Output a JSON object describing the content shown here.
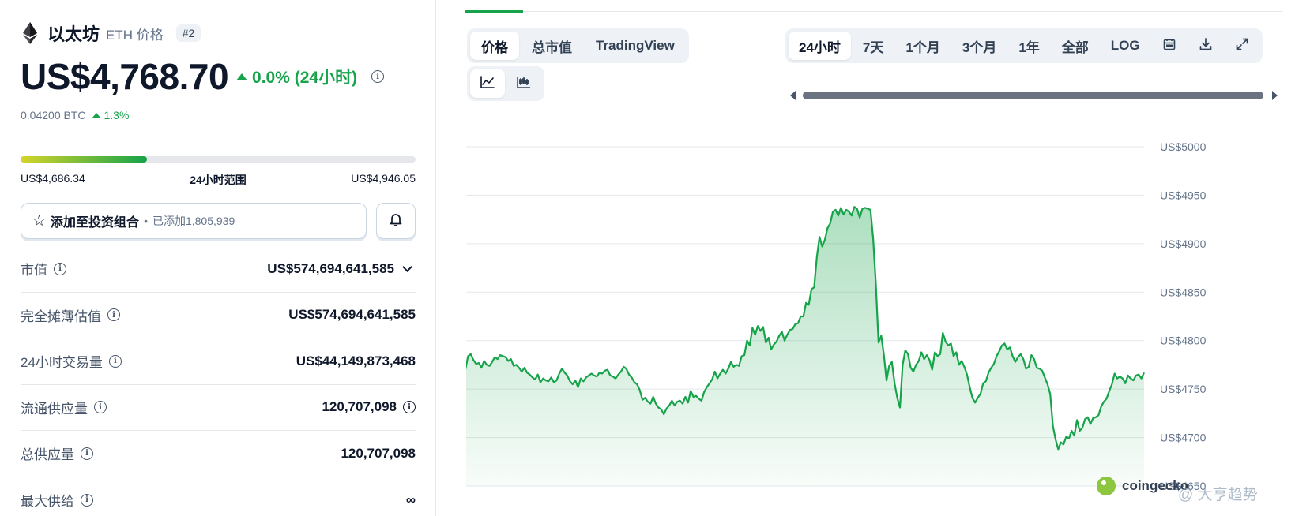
{
  "coin": {
    "name": "以太坊",
    "symbol": "ETH 价格",
    "rank": "#2",
    "price": "US$4,768.70",
    "change_24h": "0.0% (24小时)",
    "btc_price": "0.04200 BTC",
    "btc_change": "1.3%"
  },
  "range_24h": {
    "low": "US$4,686.34",
    "label": "24小时范围",
    "high": "US$4,946.05",
    "fill_fraction": 0.32
  },
  "portfolio": {
    "label": "添加至投资组合",
    "dot": "•",
    "added": "已添加1,805,939"
  },
  "stats": {
    "market_cap": {
      "label": "市值",
      "value": "US$574,694,641,585"
    },
    "fdv": {
      "label": "完全摊薄估值",
      "value": "US$574,694,641,585"
    },
    "volume": {
      "label": "24小时交易量",
      "value": "US$44,149,873,468"
    },
    "circulating": {
      "label": "流通供应量",
      "value": "120,707,098"
    },
    "total": {
      "label": "总供应量",
      "value": "120,707,098"
    },
    "max": {
      "label": "最大供给",
      "value": "∞"
    }
  },
  "chart_tabs": {
    "price": "价格",
    "market_cap": "总市值",
    "tradingview": "TradingView"
  },
  "chart_icons": {
    "line": "line-chart-icon",
    "candle": "candlestick-icon"
  },
  "time_ranges": {
    "h24": "24小时",
    "d7": "7天",
    "m1": "1个月",
    "m3": "3个月",
    "y1": "1年",
    "all": "全部",
    "log": "LOG"
  },
  "tools": {
    "calendar": "calendar-icon",
    "download": "download-icon",
    "expand": "expand-icon"
  },
  "watermark": {
    "brand": "coingecko",
    "source": "@ 大亨趋势"
  },
  "colors": {
    "up": "#16a34a",
    "line": "#16a34a",
    "area_top": "#16a34a"
  },
  "chart_data": {
    "type": "area",
    "title": "",
    "xlabel": "",
    "ylabel": "",
    "ylim": [
      4650,
      5000
    ],
    "yticks": [
      "US$5000",
      "US$4950",
      "US$4900",
      "US$4850",
      "US$4800",
      "US$4750",
      "US$4700",
      "US$4650"
    ],
    "yticks_values": [
      5000,
      4950,
      4900,
      4850,
      4800,
      4750,
      4700,
      4650
    ],
    "grid": true,
    "series": [
      {
        "values": [
          4763,
          4757,
          4762,
          4760,
          4768,
          4770,
          4784,
          4786,
          4780,
          4776,
          4777,
          4772,
          4779,
          4775,
          4774,
          4778,
          4783,
          4781,
          4785,
          4784,
          4783,
          4779,
          4781,
          4774,
          4775,
          4772,
          4768,
          4772,
          4767,
          4765,
          4762,
          4760,
          4765,
          4757,
          4761,
          4759,
          4758,
          4762,
          4757,
          4759,
          4766,
          4771,
          4767,
          4764,
          4758,
          4755,
          4759,
          4752,
          4761,
          4758,
          4762,
          4764,
          4766,
          4764,
          4763,
          4767,
          4766,
          4769,
          4770,
          4764,
          4763,
          4761,
          4765,
          4768,
          4773,
          4771,
          4765,
          4762,
          4757,
          4755,
          4749,
          4739,
          4741,
          4737,
          4735,
          4742,
          4735,
          4731,
          4729,
          4724,
          4730,
          4733,
          4738,
          4733,
          4737,
          4738,
          4735,
          4742,
          4736,
          4748,
          4742,
          4743,
          4740,
          4738,
          4747,
          4752,
          4756,
          4760,
          4768,
          4761,
          4766,
          4770,
          4766,
          4771,
          4778,
          4773,
          4775,
          4774,
          4784,
          4785,
          4800,
          4795,
          4813,
          4806,
          4815,
          4810,
          4814,
          4798,
          4803,
          4791,
          4796,
          4799,
          4805,
          4809,
          4800,
          4806,
          4811,
          4812,
          4817,
          4818,
          4825,
          4825,
          4839,
          4837,
          4853,
          4855,
          4886,
          4907,
          4897,
          4904,
          4916,
          4921,
          4933,
          4935,
          4929,
          4937,
          4930,
          4935,
          4933,
          4929,
          4938,
          4936,
          4927,
          4936,
          4937,
          4936,
          4935,
          4905,
          4858,
          4798,
          4805,
          4785,
          4759,
          4774,
          4778,
          4756,
          4741,
          4731,
          4775,
          4790,
          4786,
          4772,
          4768,
          4775,
          4779,
          4788,
          4781,
          4785,
          4780,
          4770,
          4788,
          4784,
          4786,
          4808,
          4799,
          4795,
          4797,
          4784,
          4788,
          4775,
          4779,
          4773,
          4765,
          4752,
          4741,
          4736,
          4741,
          4745,
          4756,
          4758,
          4767,
          4772,
          4776,
          4784,
          4789,
          4795,
          4797,
          4791,
          4793,
          4784,
          4778,
          4783,
          4786,
          4781,
          4771,
          4773,
          4785,
          4781,
          4772,
          4771,
          4769,
          4762,
          4755,
          4745,
          4712,
          4698,
          4688,
          4695,
          4693,
          4701,
          4699,
          4707,
          4702,
          4718,
          4707,
          4710,
          4719,
          4721,
          4714,
          4720,
          4721,
          4723,
          4732,
          4737,
          4740,
          4748,
          4755,
          4766,
          4761,
          4763,
          4761,
          4756,
          4764,
          4761,
          4759,
          4764,
          4765,
          4761,
          4767
        ]
      }
    ]
  }
}
